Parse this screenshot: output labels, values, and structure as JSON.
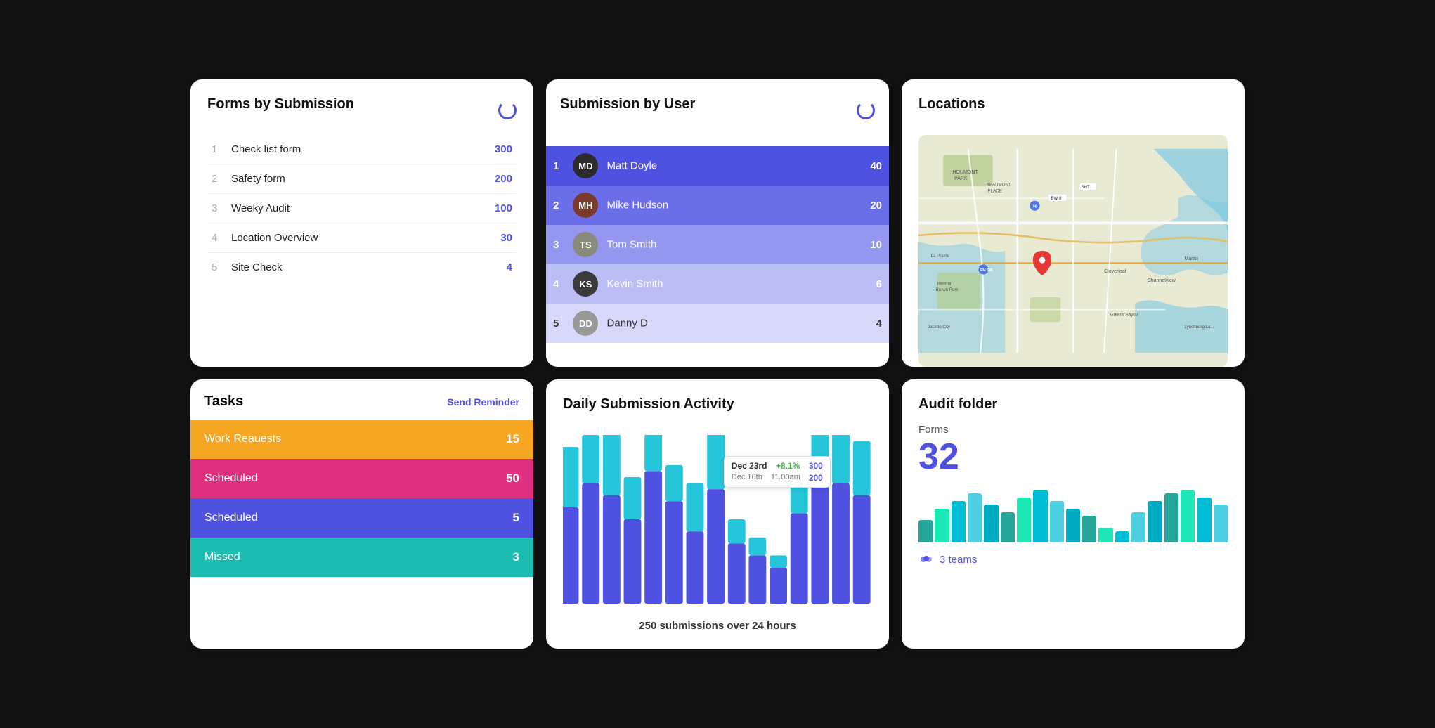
{
  "forms_by_submission": {
    "title": "Forms by Submission",
    "items": [
      {
        "num": "1",
        "name": "Check list form",
        "count": "300"
      },
      {
        "num": "2",
        "name": "Safety form",
        "count": "200"
      },
      {
        "num": "3",
        "name": "Weeky Audit",
        "count": "100"
      },
      {
        "num": "4",
        "name": "Location Overview",
        "count": "30"
      },
      {
        "num": "5",
        "name": "Site Check",
        "count": "4"
      }
    ]
  },
  "submission_by_user": {
    "title": "Submission by User",
    "items": [
      {
        "num": "1",
        "name": "Matt Doyle",
        "count": "40",
        "initials": "MD",
        "row_class": "highlight-dark"
      },
      {
        "num": "2",
        "name": "Mike Hudson",
        "count": "20",
        "initials": "MH",
        "row_class": "highlight-med"
      },
      {
        "num": "3",
        "name": "Tom Smith",
        "count": "10",
        "initials": "TS",
        "row_class": "highlight-light"
      },
      {
        "num": "4",
        "name": "Kevin Smith",
        "count": "6",
        "initials": "KS",
        "row_class": "highlight-lighter"
      },
      {
        "num": "5",
        "name": "Danny D",
        "count": "4",
        "initials": "DD",
        "row_class": "highlight-lightest"
      }
    ]
  },
  "locations": {
    "title": "Locations"
  },
  "tasks": {
    "title": "Tasks",
    "send_reminder": "Send Reminder",
    "items": [
      {
        "label": "Work Reauests",
        "count": "15",
        "color_class": "task-orange"
      },
      {
        "label": "Scheduled",
        "count": "50",
        "color_class": "task-red"
      },
      {
        "label": "Scheduled",
        "count": "5",
        "color_class": "task-purple"
      },
      {
        "label": "Missed",
        "count": "3",
        "color_class": "task-teal"
      }
    ]
  },
  "daily_submission": {
    "title": "Daily Submission Activity",
    "subtitle": "250 submissions over 24 hours",
    "tooltip": {
      "date": "Dec 23rd",
      "change": "+8.1%",
      "value1": "300",
      "sub_date": "Dec 16th",
      "sub_time": "11.00am",
      "value2": "200"
    },
    "bars": [
      {
        "dark": 80,
        "light": 50
      },
      {
        "dark": 100,
        "light": 40
      },
      {
        "dark": 90,
        "light": 55
      },
      {
        "dark": 70,
        "light": 35
      },
      {
        "dark": 110,
        "light": 45
      },
      {
        "dark": 85,
        "light": 30
      },
      {
        "dark": 60,
        "light": 40
      },
      {
        "dark": 95,
        "light": 50
      },
      {
        "dark": 50,
        "light": 20
      },
      {
        "dark": 40,
        "light": 15
      },
      {
        "dark": 30,
        "light": 10
      },
      {
        "dark": 75,
        "light": 35
      },
      {
        "dark": 120,
        "light": 60
      },
      {
        "dark": 100,
        "light": 50
      },
      {
        "dark": 90,
        "light": 45
      }
    ]
  },
  "audit_folder": {
    "title": "Audit folder",
    "forms_label": "Forms",
    "count": "32",
    "teams_count": "3 teams",
    "bars": [
      30,
      45,
      55,
      65,
      50,
      40,
      60,
      70,
      55,
      45,
      35,
      20,
      15,
      40,
      55,
      65,
      70,
      60,
      50
    ]
  }
}
